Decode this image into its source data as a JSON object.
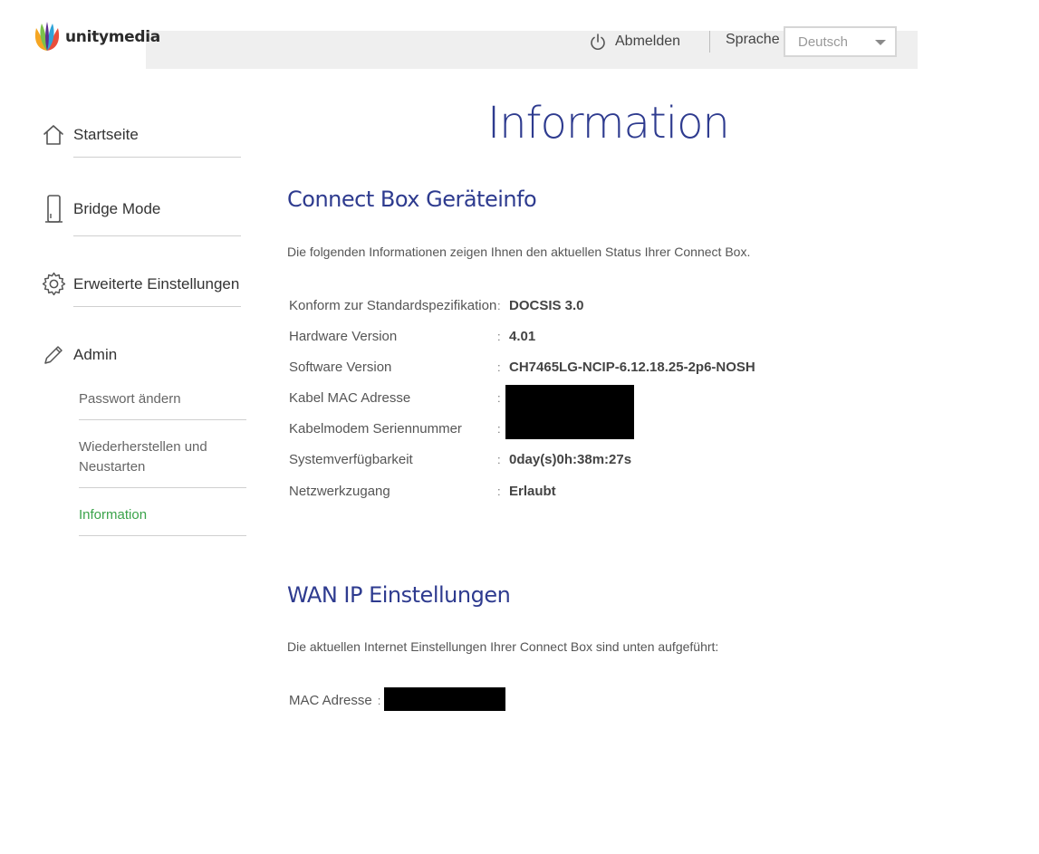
{
  "header": {
    "brand": "unitymedia",
    "logout_label": "Abmelden",
    "language_label": "Sprache",
    "language_selected": "Deutsch"
  },
  "sidebar": {
    "items": [
      {
        "label": "Startseite",
        "icon": "home-icon"
      },
      {
        "label": "Bridge Mode",
        "icon": "device-icon"
      },
      {
        "label": "Erweiterte Einstellungen",
        "icon": "gear-icon"
      },
      {
        "label": "Admin",
        "icon": "pencil-icon"
      }
    ],
    "admin_sub": [
      {
        "label": "Passwort ändern"
      },
      {
        "label": "Wiederherstellen und"
      },
      {
        "label": "Neustarten"
      },
      {
        "label": "Information",
        "active": true
      }
    ]
  },
  "main": {
    "title": "Information",
    "device_section": {
      "title": "Connect Box Geräteinfo",
      "description": "Die folgenden Informationen zeigen Ihnen den aktuellen Status Ihrer Connect Box.",
      "rows": [
        {
          "label": "Konform zur Standardspezifikation",
          "colon": ":",
          "value": "DOCSIS 3.0"
        },
        {
          "label": "Hardware Version",
          "colon": ":",
          "value": "4.01"
        },
        {
          "label": "Software Version",
          "colon": ":",
          "value": "CH7465LG-NCIP-6.12.18.25-2p6-NOSH"
        },
        {
          "label": "Kabel MAC Adresse",
          "colon": ":",
          "value": ""
        },
        {
          "label": "Kabelmodem Seriennummer",
          "colon": ":",
          "value": ""
        },
        {
          "label": "Systemverfügbarkeit",
          "colon": ":",
          "value": "0day(s)0h:38m:27s"
        },
        {
          "label": "Netzwerkzugang",
          "colon": ":",
          "value": "Erlaubt"
        }
      ]
    },
    "wan_section": {
      "title": "WAN IP Einstellungen",
      "description": "Die aktuellen Internet Einstellungen Ihrer Connect Box sind unten aufgeführt:",
      "mac_label": "MAC Adresse",
      "mac_colon": ":"
    }
  },
  "colors": {
    "accent_blue": "#2e3b8f",
    "active_green": "#3aa34a",
    "header_bg": "#efefef"
  }
}
